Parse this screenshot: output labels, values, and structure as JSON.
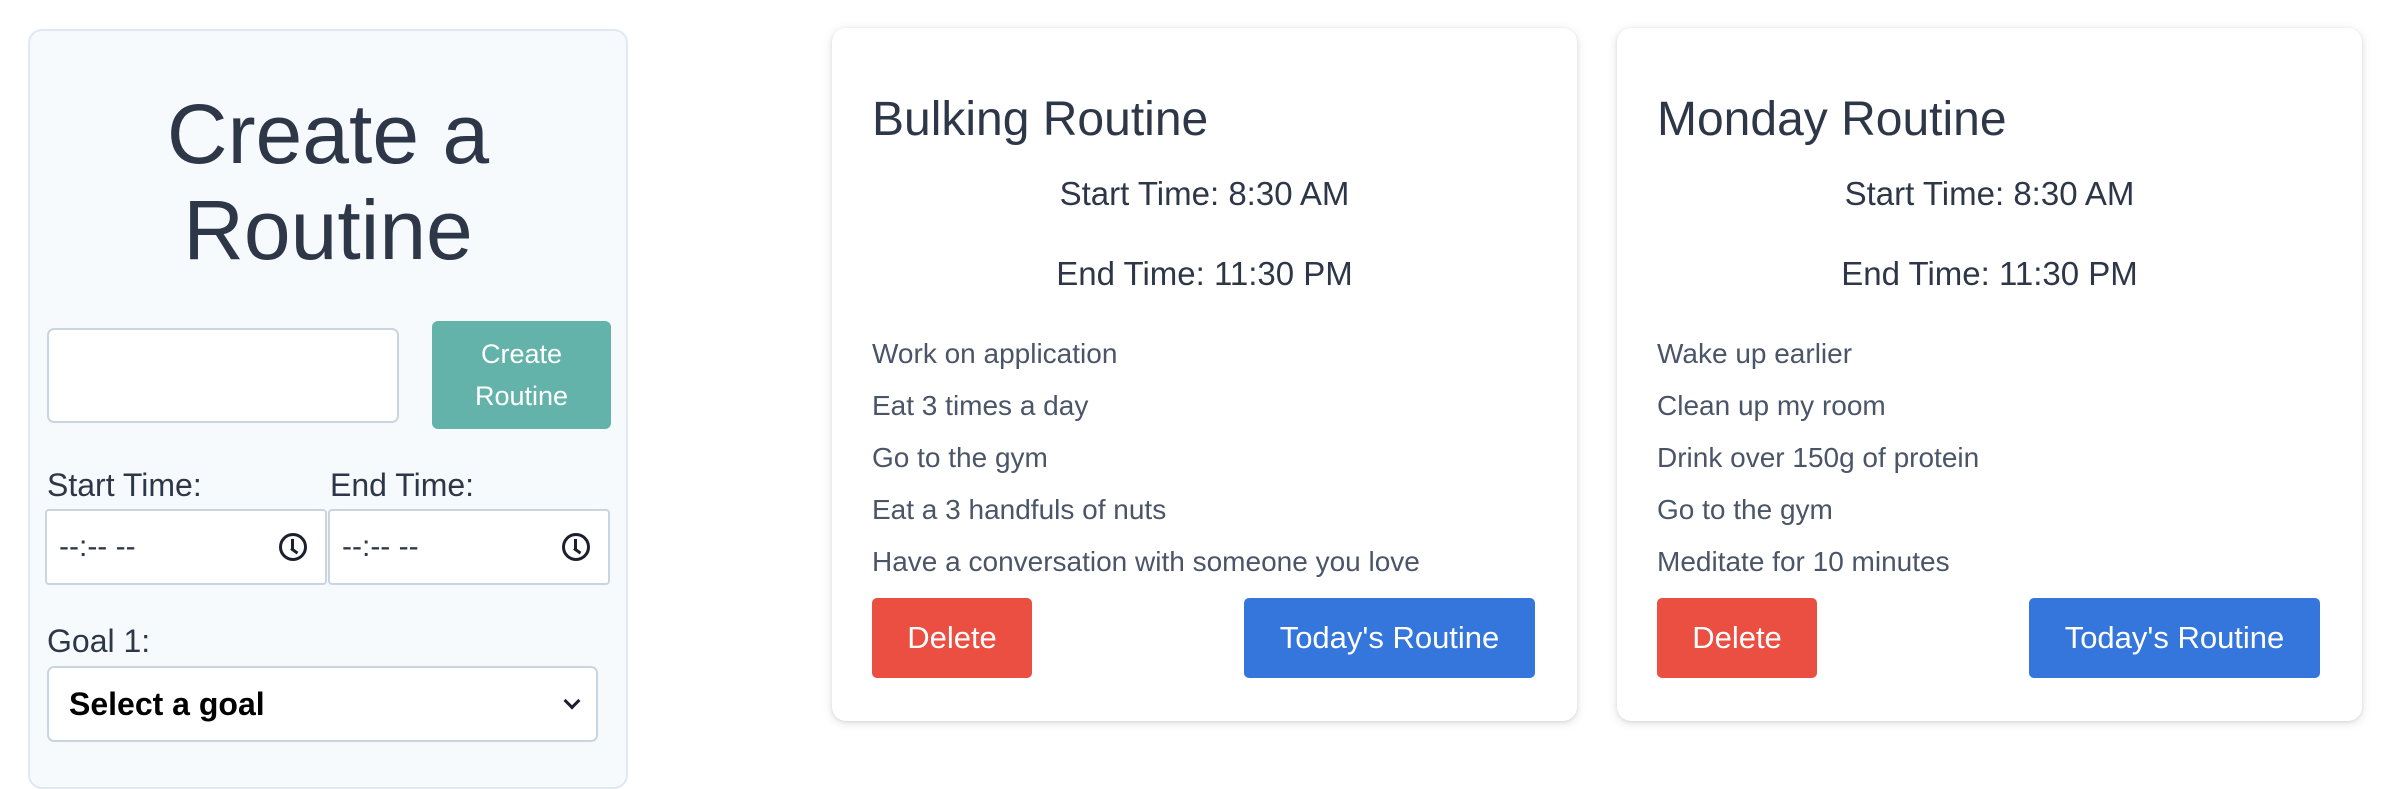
{
  "create_panel": {
    "title": "Create a Routine",
    "name_input_value": "",
    "create_button_label": "Create Routine",
    "start_time_label": "Start Time:",
    "start_time_value": "--:-- --",
    "end_time_label": "End Time:",
    "end_time_value": "--:-- --",
    "goal_label": "Goal 1:",
    "goal_select_value": "Select a goal"
  },
  "routines": [
    {
      "title": "Bulking Routine",
      "start_time": "Start Time: 8:30 AM",
      "end_time": "End Time: 11:30 PM",
      "goals": [
        "Work on application",
        "Eat 3 times a day",
        "Go to the gym",
        "Eat a 3 handfuls of nuts",
        "Have a conversation with someone you love"
      ],
      "delete_label": "Delete",
      "today_label": "Today's Routine"
    },
    {
      "title": "Monday Routine",
      "start_time": "Start Time: 8:30 AM",
      "end_time": "End Time: 11:30 PM",
      "goals": [
        "Wake up earlier",
        "Clean up my room",
        "Drink over 150g of protein",
        "Go to the gym",
        "Meditate for 10 minutes"
      ],
      "delete_label": "Delete",
      "today_label": "Today's Routine"
    }
  ],
  "icons": {
    "time_picker": "clock-icon",
    "select_dropdown": "chevron-down-icon"
  },
  "colors": {
    "create_button": "#63b3aa",
    "delete_button": "#ea4f42",
    "today_button": "#3476dc",
    "text": "#2d3748"
  }
}
